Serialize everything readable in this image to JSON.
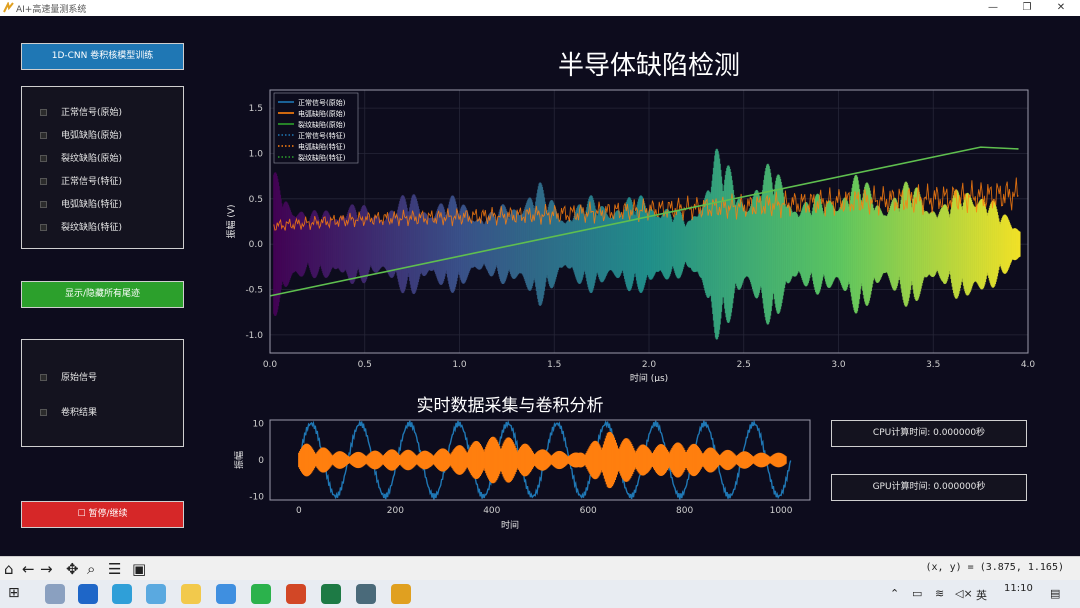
{
  "window": {
    "title": "AI+高速量测系统",
    "minimize": "—",
    "restore": "❐",
    "close": "✕"
  },
  "sidebar": {
    "train_button": "1D-CNN 卷积核模型训练",
    "checkboxes_top": [
      "正常信号(原始)",
      "电弧缺陷(原始)",
      "裂纹缺陷(原始)",
      "正常信号(特征)",
      "电弧缺陷(特征)",
      "裂纹缺陷(特征)"
    ],
    "toggle_button": "显示/隐藏所有尾迹",
    "checkboxes_bottom": [
      "原始信号",
      "卷积结果"
    ],
    "pause_button": "☐ 暂停/继续"
  },
  "main_chart_title": "半导体缺陷检测",
  "sub_chart_title": "实时数据采集与卷积分析",
  "cpu_time": "CPU计算时间: 0.000000秒",
  "gpu_time": "GPU计算时间: 0.000000秒",
  "toolbar": {
    "coord_readout": "(x, y) = (3.875, 1.165)"
  },
  "taskbar": {
    "clock": "11:10",
    "ime": "英"
  },
  "colors": {
    "accent_blue": "#1f77b4",
    "accent_green": "#2ca02c",
    "accent_red": "#d62728",
    "orange": "#ff7f0e"
  },
  "chart_data": [
    {
      "type": "line",
      "title": "半导体缺陷检测",
      "xlabel": "时间 (μs)",
      "ylabel": "振幅 (V)",
      "xlim": [
        0.0,
        4.0
      ],
      "ylim": [
        -1.2,
        1.7
      ],
      "xticks": [
        0.0,
        0.5,
        1.0,
        1.5,
        2.0,
        2.5,
        3.0,
        3.5,
        4.0
      ],
      "yticks": [
        -1.0,
        -0.5,
        0.0,
        0.5,
        1.0,
        1.5
      ],
      "legend_position": "top-left",
      "grid": true,
      "series": [
        {
          "name": "正常信号(原始)",
          "style": "solid",
          "color": "#1f77b4"
        },
        {
          "name": "电弧缺陷(原始)",
          "style": "solid",
          "color": "#ff7f0e",
          "x": [
            0.0,
            0.5,
            1.0,
            1.5,
            2.0,
            2.5,
            3.0,
            3.5,
            3.95
          ],
          "y": [
            0.2,
            0.28,
            0.3,
            0.33,
            0.38,
            0.42,
            0.47,
            0.5,
            0.55
          ]
        },
        {
          "name": "裂纹缺陷(原始)",
          "style": "solid",
          "color": "#2ca02c",
          "x": [
            0.0,
            3.75,
            3.95
          ],
          "y": [
            -0.57,
            1.07,
            1.05
          ]
        },
        {
          "name": "正常信号(特征)",
          "style": "dotted",
          "color": "#1f77b4"
        },
        {
          "name": "电弧缺陷(特征)",
          "style": "dotted",
          "color": "#ff7f0e"
        },
        {
          "name": "裂纹缺陷(特征)",
          "style": "dotted",
          "color": "#2ca02c"
        }
      ],
      "burst_envelope": {
        "x": [
          0.02,
          0.2,
          0.4,
          0.55,
          0.75,
          0.85,
          1.0,
          1.15,
          1.3,
          1.42,
          1.55,
          1.7,
          1.85,
          2.0,
          2.1,
          2.22,
          2.35,
          2.5,
          2.65,
          2.8,
          2.95,
          3.1,
          3.25,
          3.4,
          3.55,
          3.7,
          3.85,
          3.95
        ],
        "amp": [
          0.85,
          0.35,
          0.5,
          0.4,
          0.6,
          0.5,
          0.55,
          0.35,
          0.55,
          0.7,
          0.4,
          0.55,
          0.5,
          0.6,
          0.45,
          0.3,
          1.15,
          0.6,
          0.95,
          0.5,
          0.6,
          0.8,
          0.55,
          0.75,
          0.45,
          0.8,
          0.4,
          0.25
        ]
      }
    },
    {
      "type": "line",
      "title": "实时数据采集与卷积分析",
      "xlabel": "时间",
      "ylabel": "振幅",
      "xlim": [
        -60,
        1060
      ],
      "ylim": [
        -11,
        11
      ],
      "xticks": [
        0,
        200,
        400,
        600,
        800,
        1000
      ],
      "yticks": [
        -10,
        0,
        10
      ],
      "series": [
        {
          "name": "原始信号",
          "color": "#1f77b4",
          "amplitude": 10,
          "cycles": 10,
          "x_range": [
            0,
            1020
          ]
        },
        {
          "name": "卷积结果",
          "color": "#ff7f0e",
          "bursts_x": [
            0,
            100,
            200,
            270,
            330,
            420,
            500,
            580,
            640,
            720,
            800,
            870,
            960
          ],
          "bursts_amp": [
            5,
            2,
            3,
            2.5,
            4,
            7,
            3,
            2,
            8,
            4,
            5,
            3,
            2
          ]
        }
      ]
    }
  ]
}
